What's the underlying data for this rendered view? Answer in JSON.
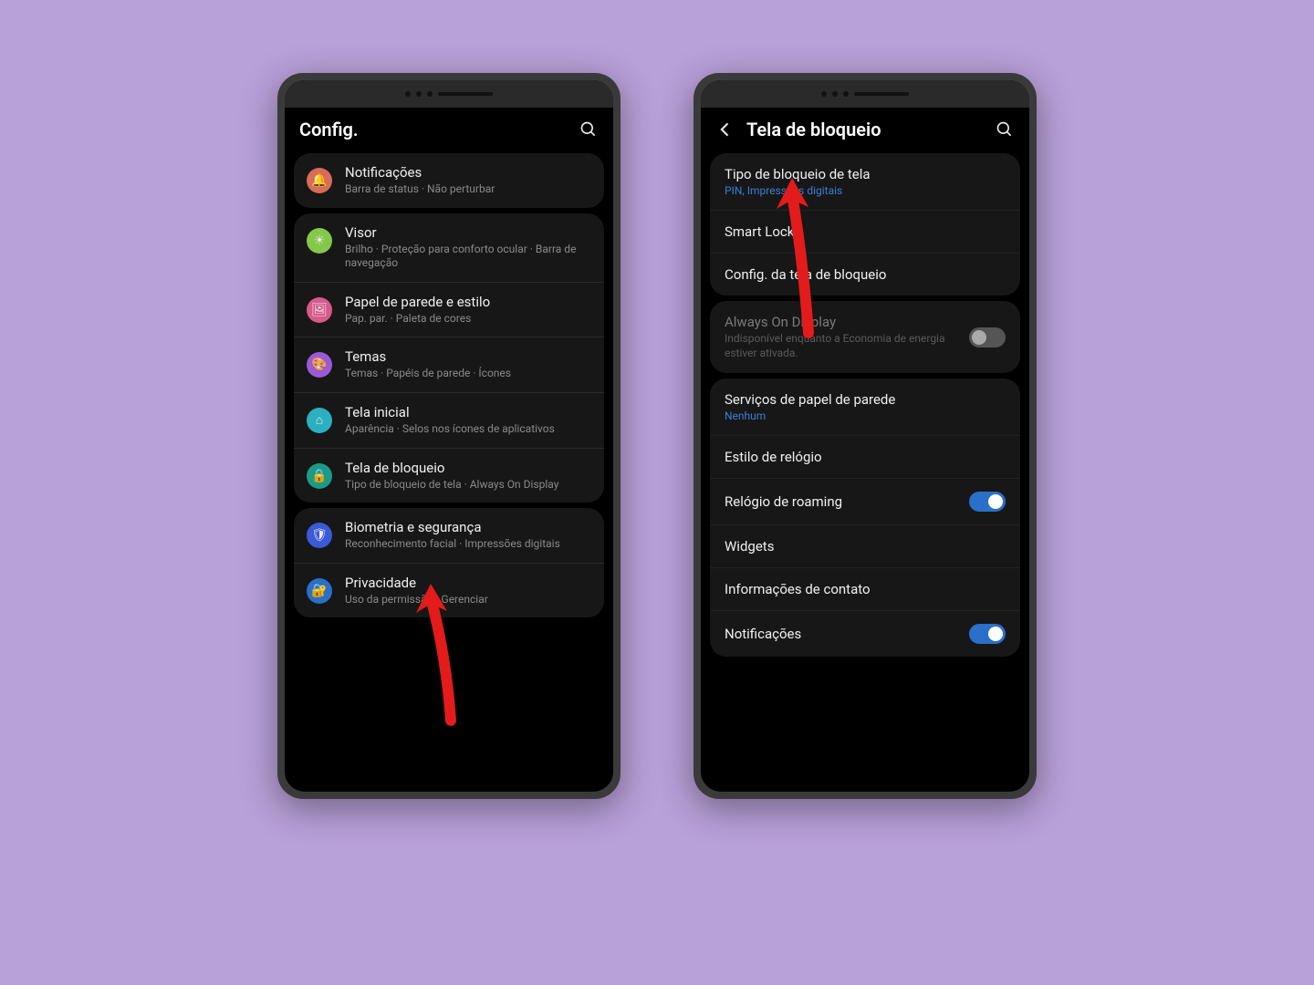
{
  "phone1": {
    "header_title": "Config.",
    "groups": [
      [
        {
          "icon": "bell-icon",
          "bg": "#d86b5a",
          "title": "Notificações",
          "sub": "Barra de status  ·  Não perturbar"
        }
      ],
      [
        {
          "icon": "sun-icon",
          "bg": "#84c84a",
          "title": "Visor",
          "sub": "Brilho  ·  Proteção para conforto ocular  ·  Barra de navegação"
        },
        {
          "icon": "wallpaper-icon",
          "bg": "#d85a8a",
          "title": "Papel de parede e estilo",
          "sub": "Pap. par.  ·  Paleta de cores"
        },
        {
          "icon": "theme-icon",
          "bg": "#9a5ad8",
          "title": "Temas",
          "sub": "Temas  ·  Papéis de parede  ·  Ícones"
        },
        {
          "icon": "home-icon",
          "bg": "#2ab0c0",
          "title": "Tela inicial",
          "sub": "Aparência  ·  Selos nos ícones de aplicativos"
        },
        {
          "icon": "lock-icon",
          "bg": "#1a9b8a",
          "title": "Tela de bloqueio",
          "sub": "Tipo de bloqueio de tela  ·  Always On Display"
        }
      ],
      [
        {
          "icon": "shield-icon",
          "bg": "#3a5ad8",
          "title": "Biometria e segurança",
          "sub": "Reconhecimento facial  ·  Impressões digitais"
        },
        {
          "icon": "privacy-icon",
          "bg": "#2a6fc9",
          "title": "Privacidade",
          "sub": "Uso da permissão  ·  Gerenciar"
        }
      ]
    ]
  },
  "phone2": {
    "header_title": "Tela de bloqueio",
    "section1": [
      {
        "title": "Tipo de bloqueio de tela",
        "sub": "PIN, Impressões digitais",
        "sub_blue": true
      },
      {
        "title": "Smart Lock"
      },
      {
        "title": "Config. da tela de bloqueio"
      }
    ],
    "aod": {
      "title": "Always On Display",
      "sub": "Indisponível enquanto a Economia de energia estiver ativada.",
      "toggle": false
    },
    "section2": [
      {
        "title": "Serviços de papel de parede",
        "sub": "Nenhum",
        "sub_blue": true
      },
      {
        "title": "Estilo de relógio"
      },
      {
        "title": "Relógio de roaming",
        "toggle": true
      },
      {
        "title": "Widgets"
      },
      {
        "title": "Informações de contato"
      },
      {
        "title": "Notificações",
        "toggle": true
      }
    ]
  },
  "icons": {
    "bell-icon": "🔔",
    "sun-icon": "☀",
    "wallpaper-icon": "🖼",
    "theme-icon": "🎨",
    "home-icon": "⌂",
    "lock-icon": "🔒",
    "shield-icon": "🛡",
    "privacy-icon": "🔐"
  }
}
